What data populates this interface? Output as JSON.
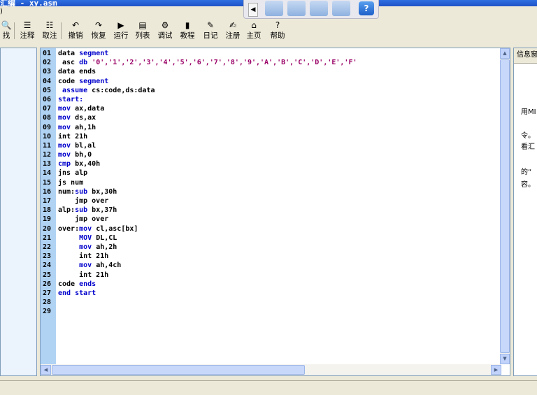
{
  "window": {
    "title": "汇编 - xy.asm"
  },
  "toolbar": {
    "items": [
      {
        "label": "找",
        "icon": "find-icon",
        "glyph": "🔍"
      },
      {
        "label": "注释",
        "icon": "comment-icon",
        "glyph": "☰"
      },
      {
        "label": "取注",
        "icon": "uncomment-icon",
        "glyph": "☷"
      },
      {
        "label": "撤销",
        "icon": "undo-icon",
        "glyph": "↶"
      },
      {
        "label": "恢复",
        "icon": "redo-icon",
        "glyph": "↷"
      },
      {
        "label": "运行",
        "icon": "run-icon",
        "glyph": "▶"
      },
      {
        "label": "列表",
        "icon": "list-icon",
        "glyph": "▤"
      },
      {
        "label": "调试",
        "icon": "debug-icon",
        "glyph": "⚙"
      },
      {
        "label": "教程",
        "icon": "tutorial-icon",
        "glyph": "▮"
      },
      {
        "label": "日记",
        "icon": "diary-icon",
        "glyph": "✎"
      },
      {
        "label": "注册",
        "icon": "register-icon",
        "glyph": "✍"
      },
      {
        "label": "主页",
        "icon": "home-icon",
        "glyph": "⌂"
      },
      {
        "label": "帮助",
        "icon": "help-icon",
        "glyph": "?"
      }
    ]
  },
  "editor": {
    "lines": [
      {
        "n": "01",
        "tokens": [
          {
            "t": "data "
          },
          {
            "t": "segment",
            "k": "kw"
          }
        ]
      },
      {
        "n": "02",
        "tokens": [
          {
            "t": " asc "
          },
          {
            "t": "db",
            "k": "kw"
          },
          {
            "t": " "
          },
          {
            "t": "'0','1','2','3','4','5','6','7','8','9','A','B','C','D','E','F'",
            "k": "st"
          }
        ]
      },
      {
        "n": "03",
        "tokens": [
          {
            "t": "data ends"
          }
        ]
      },
      {
        "n": "04",
        "tokens": [
          {
            "t": "code "
          },
          {
            "t": "segment",
            "k": "kw"
          }
        ]
      },
      {
        "n": "05",
        "tokens": [
          {
            "t": " "
          },
          {
            "t": "assume",
            "k": "kw"
          },
          {
            "t": " cs:code,ds:data"
          }
        ]
      },
      {
        "n": "06",
        "tokens": [
          {
            "t": "start:",
            "k": "kw"
          }
        ]
      },
      {
        "n": "07",
        "tokens": [
          {
            "t": "mov",
            "k": "kw"
          },
          {
            "t": " ax,data"
          }
        ]
      },
      {
        "n": "08",
        "tokens": [
          {
            "t": "mov",
            "k": "kw"
          },
          {
            "t": " ds,ax"
          }
        ]
      },
      {
        "n": "09",
        "tokens": [
          {
            "t": "mov",
            "k": "kw"
          },
          {
            "t": " ah,1h"
          }
        ]
      },
      {
        "n": "10",
        "tokens": [
          {
            "t": "int 21h"
          }
        ]
      },
      {
        "n": "11",
        "tokens": [
          {
            "t": "mov",
            "k": "kw"
          },
          {
            "t": " bl,al"
          }
        ]
      },
      {
        "n": "12",
        "tokens": [
          {
            "t": "mov",
            "k": "kw"
          },
          {
            "t": " bh,0"
          }
        ]
      },
      {
        "n": "13",
        "tokens": [
          {
            "t": "cmp",
            "k": "kw"
          },
          {
            "t": " bx,40h"
          }
        ]
      },
      {
        "n": "14",
        "tokens": [
          {
            "t": "jns alp"
          }
        ]
      },
      {
        "n": "15",
        "tokens": [
          {
            "t": "js num"
          }
        ]
      },
      {
        "n": "16",
        "tokens": [
          {
            "t": "num:"
          },
          {
            "t": "sub",
            "k": "kw"
          },
          {
            "t": " bx,30h"
          }
        ]
      },
      {
        "n": "17",
        "tokens": [
          {
            "t": "    jmp over"
          }
        ]
      },
      {
        "n": "18",
        "tokens": [
          {
            "t": "alp:"
          },
          {
            "t": "sub",
            "k": "kw"
          },
          {
            "t": " bx,37h"
          }
        ]
      },
      {
        "n": "19",
        "tokens": [
          {
            "t": "    jmp over"
          }
        ]
      },
      {
        "n": "20",
        "tokens": [
          {
            "t": "over:"
          },
          {
            "t": "mov",
            "k": "kw"
          },
          {
            "t": " cl,asc[bx]"
          }
        ]
      },
      {
        "n": "21",
        "tokens": [
          {
            "t": "     "
          },
          {
            "t": "MOV",
            "k": "kw"
          },
          {
            "t": " DL,CL"
          }
        ]
      },
      {
        "n": "22",
        "tokens": [
          {
            "t": "     "
          },
          {
            "t": "mov",
            "k": "kw"
          },
          {
            "t": " ah,2h"
          }
        ]
      },
      {
        "n": "23",
        "tokens": [
          {
            "t": "     int 21h"
          }
        ]
      },
      {
        "n": "24",
        "tokens": [
          {
            "t": "     "
          },
          {
            "t": "mov",
            "k": "kw"
          },
          {
            "t": " ah,4ch"
          }
        ]
      },
      {
        "n": "25",
        "tokens": [
          {
            "t": "     int 21h"
          }
        ]
      },
      {
        "n": "26",
        "tokens": [
          {
            "t": "code "
          },
          {
            "t": "ends",
            "k": "kw"
          }
        ]
      },
      {
        "n": "27",
        "tokens": [
          {
            "t": "end start",
            "k": "kw"
          }
        ]
      },
      {
        "n": "28",
        "tokens": []
      },
      {
        "n": "29",
        "tokens": []
      }
    ]
  },
  "info_panel": {
    "header": "信息窗",
    "lines": [
      "用MI",
      "令。",
      "看汇",
      "的“",
      "容。"
    ]
  },
  "colors": {
    "keyword": "#0000cc",
    "string": "#990066",
    "gutter": "#b0d3f4"
  }
}
